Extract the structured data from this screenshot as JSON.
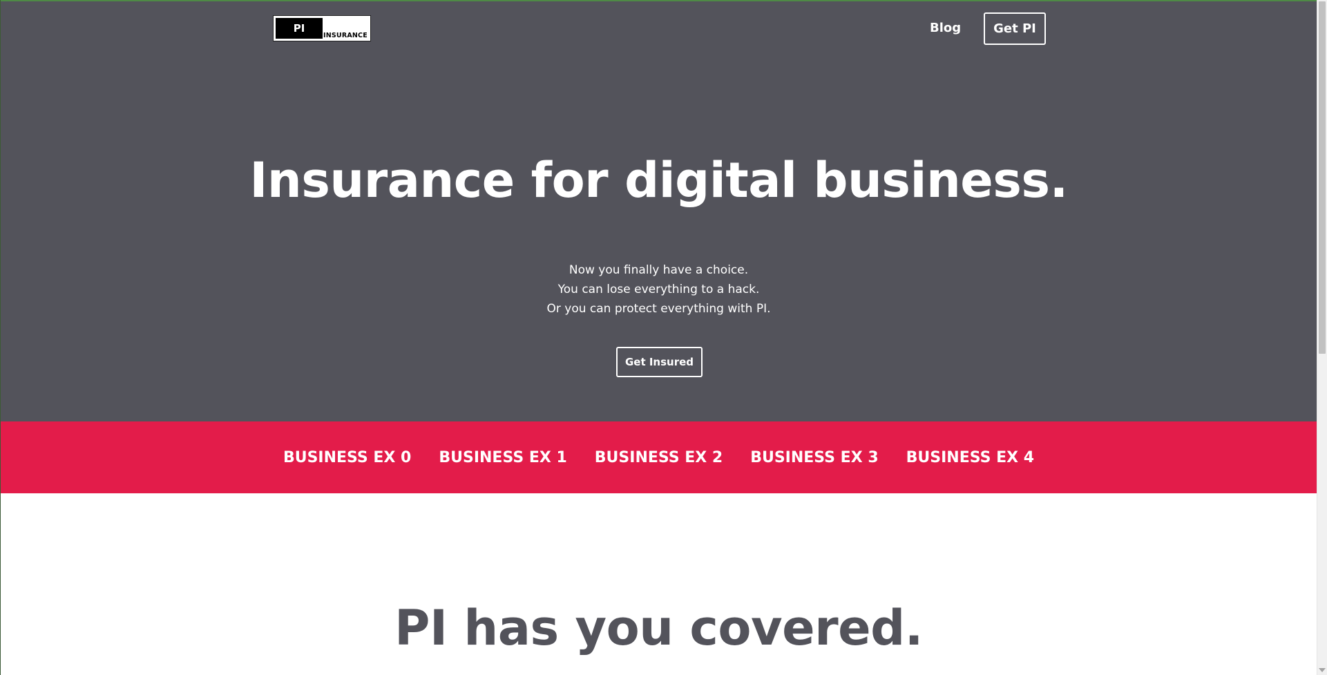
{
  "header": {
    "logo": {
      "mark": "PI",
      "word": "INSURANCE"
    },
    "nav": {
      "blog_label": "Blog",
      "get_pi_label": "Get PI"
    }
  },
  "hero": {
    "title": "Insurance for digital business.",
    "lines": [
      "Now you finally have a choice.",
      "You can lose everything to a hack.",
      "Or you can protect everything with PI."
    ],
    "cta_label": "Get Insured"
  },
  "business_band": {
    "items": [
      "BUSINESS EX 0",
      "BUSINESS EX 1",
      "BUSINESS EX 2",
      "BUSINESS EX 3",
      "BUSINESS EX 4"
    ]
  },
  "section": {
    "title": "PI has you covered."
  },
  "colors": {
    "hero_bg": "#53535b",
    "accent_red": "#e31c4a",
    "text_light": "#ffffff",
    "text_dark": "#53535b"
  }
}
